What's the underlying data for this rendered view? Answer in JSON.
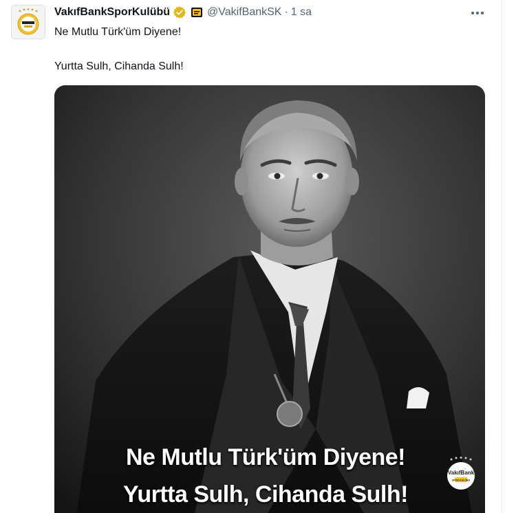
{
  "tweet": {
    "author_name": "VakıfBankSporKulübü",
    "handle": "@VakifBankSK",
    "separator": "·",
    "time": "1 sa",
    "text_line_1": "Ne Mutlu Türk'üm Diyene!",
    "text_line_2": "Yurtta Sulh, Cihanda Sulh!"
  },
  "media": {
    "caption_line_1": "Ne Mutlu Türk'üm Diyene!",
    "caption_line_2": "Yurtta Sulh, Cihanda Sulh!",
    "watermark_brand": "VakıfBank",
    "watermark_sub": "SPOR KULÜBÜ"
  },
  "avatar": {
    "brand": "VakıfBank",
    "sub": "SPOR KULÜBÜ"
  },
  "colors": {
    "text_primary": "#0f1419",
    "text_secondary": "#536471",
    "verified_gold": "#e2b719",
    "brand_gold": "#f2c12e"
  },
  "icons": {
    "verified": "verified-badge-icon",
    "affiliate": "affiliate-badge-icon",
    "more": "more-icon"
  }
}
